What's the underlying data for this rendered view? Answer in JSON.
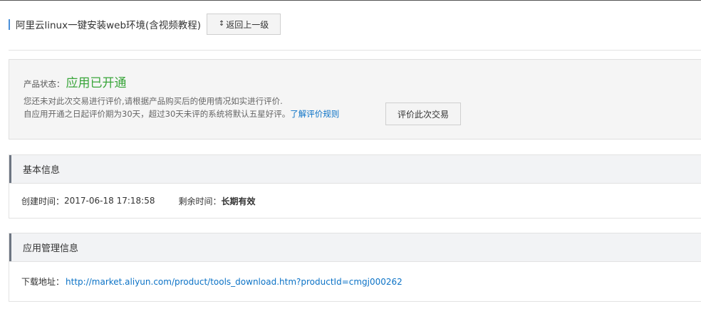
{
  "header": {
    "title": "阿里云linux一键安装web环境(含视频教程)",
    "back_icon": "↕",
    "back_label": "返回上一级"
  },
  "status": {
    "label": "产品状态：",
    "value": "应用已开通",
    "hint_line1": "您还未对此次交易进行评价,请根据产品购买后的使用情况如实进行评价.",
    "hint_line2": "自应用开通之日起评价期为30天，超过30天未评的系统将默认五星好评。",
    "rules_link": "了解评价规则",
    "rate_button": "评价此次交易"
  },
  "basic_info": {
    "heading": "基本信息",
    "created_label": "创建时间：",
    "created_value": "2017-06-18 17:18:58",
    "remaining_label": "剩余时间：",
    "remaining_value": "长期有效"
  },
  "app_info": {
    "heading": "应用管理信息",
    "download_label": "下载地址：",
    "download_url": "http://market.aliyun.com/product/tools_download.htm?productId=cmgj000262"
  },
  "colors": {
    "status_green": "#39a53a",
    "link_blue": "#0b72c6",
    "title_accent": "#4a90d9"
  }
}
